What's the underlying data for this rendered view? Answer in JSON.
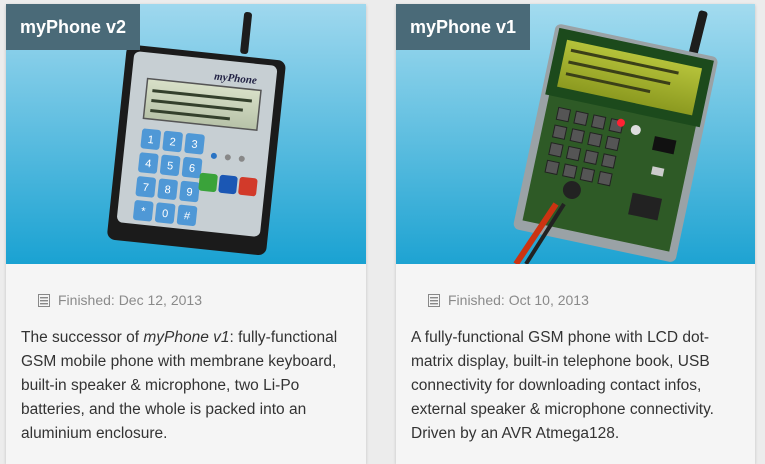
{
  "cards": [
    {
      "title": "myPhone v2",
      "meta": "Finished: Dec 12, 2013",
      "desc_pre": "The successor of ",
      "desc_em": "myPhone v1",
      "desc_post": ": fully-functional GSM mobile phone with membrane keyboard, built-in speaker & microphone, two Li-Po batteries, and the whole is packed into an aluminium enclosure.",
      "device_brand": "myPhone",
      "keys": [
        "1",
        "2",
        "3",
        "4",
        "5",
        "6",
        "7",
        "8",
        "9",
        "*",
        "0",
        "#"
      ]
    },
    {
      "title": "myPhone v1",
      "meta": "Finished: Oct 10, 2013",
      "desc": "A fully-functional GSM phone with LCD dot-matrix display, built-in telephone book, USB connectivity for downloading contact infos, external speaker & microphone connectivity. Driven by an AVR Atmega128."
    }
  ],
  "colors": {
    "badge": "#4a6a78",
    "sky_top": "#8fd0ea",
    "sky_bottom": "#1ea0d0"
  }
}
